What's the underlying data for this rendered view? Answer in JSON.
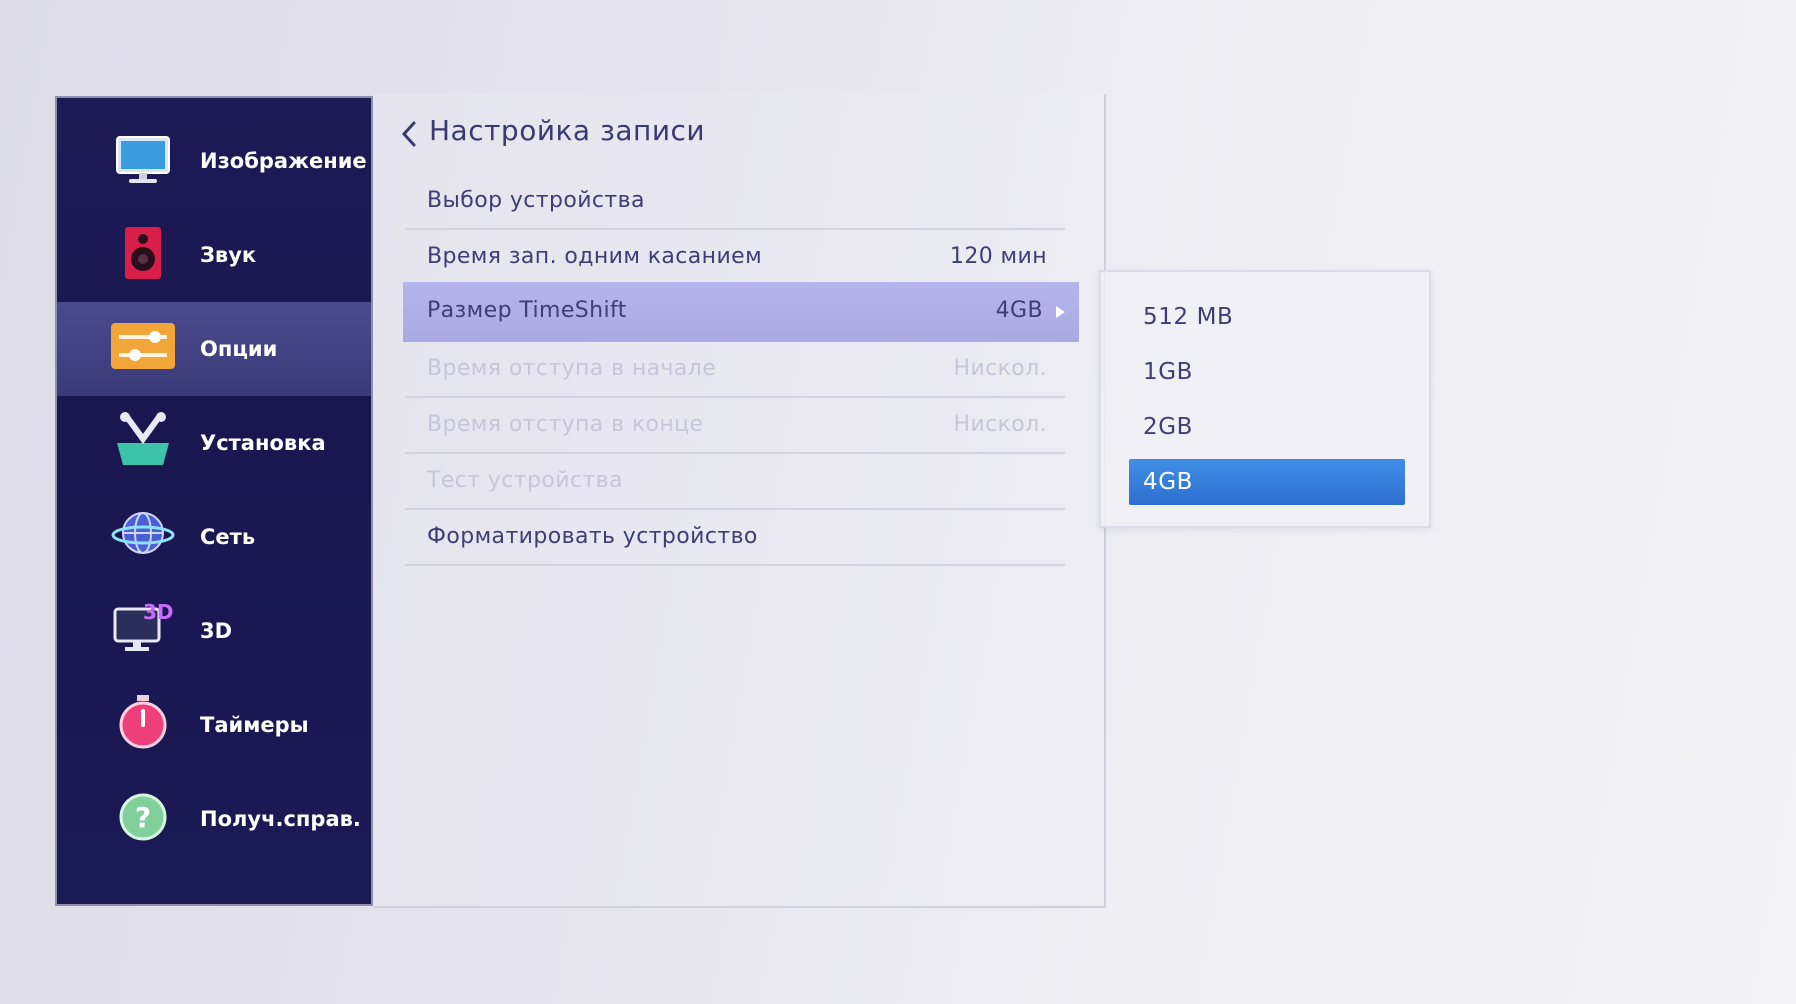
{
  "sidebar": {
    "items": [
      {
        "label": "Изображение",
        "icon": "monitor-icon"
      },
      {
        "label": "Звук",
        "icon": "speaker-icon"
      },
      {
        "label": "Опции",
        "icon": "options-sliders-icon"
      },
      {
        "label": "Установка",
        "icon": "tools-icon"
      },
      {
        "label": "Сеть",
        "icon": "globe-network-icon"
      },
      {
        "label": "3D",
        "icon": "3d-monitor-icon"
      },
      {
        "label": "Таймеры",
        "icon": "stopwatch-icon"
      },
      {
        "label": "Получ.справ.",
        "icon": "help-question-icon"
      }
    ],
    "active_index": 2
  },
  "panel": {
    "title": "Настройка записи",
    "rows": [
      {
        "label": "Выбор устройства",
        "value": ""
      },
      {
        "label": "Время зап. одним касанием",
        "value": "120 мин"
      },
      {
        "label": "Размер TimeShift",
        "value": "4GB"
      },
      {
        "label": "Время отступа в начале",
        "value": "Нискол."
      },
      {
        "label": "Время отступа в конце",
        "value": "Нискол."
      },
      {
        "label": "Тест устройства",
        "value": ""
      },
      {
        "label": "Форматировать устройство",
        "value": ""
      }
    ]
  },
  "popup": {
    "options": [
      "512 MB",
      "1GB",
      "2GB",
      "4GB"
    ],
    "selected": "4GB"
  },
  "colors": {
    "sidebar_bg": "#1e1a55",
    "active_row": "#b6b5ea",
    "selected_option": "#3f8ee6",
    "text": "#3e3e75"
  }
}
